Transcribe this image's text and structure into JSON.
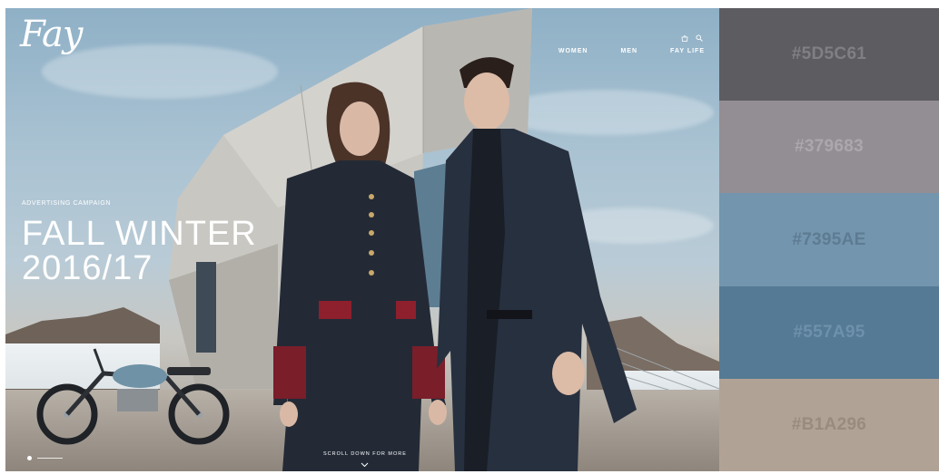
{
  "brand": {
    "logo_text": "Fay"
  },
  "nav": {
    "items": [
      "WOMEN",
      "MEN",
      "FAY LIFE"
    ]
  },
  "utility": {
    "icons": [
      "bag-icon",
      "search-icon"
    ]
  },
  "hero": {
    "kicker": "ADVERTISING CAMPAIGN",
    "headline_line1": "FALL WINTER",
    "headline_line2": "2016/17",
    "scroll_text": "SCROLL DOWN FOR MORE"
  },
  "palette": {
    "swatches": [
      {
        "label": "#5D5C61",
        "color": "#5D5C61",
        "text_color": "#807f84"
      },
      {
        "label": "#379683",
        "color": "#938E94",
        "text_color": "#aca7ad"
      },
      {
        "label": "#7395AE",
        "color": "#7395AE",
        "text_color": "#5d7b92"
      },
      {
        "label": "#557A95",
        "color": "#557A95",
        "text_color": "#6e91ab"
      },
      {
        "label": "#B1A296",
        "color": "#B1A296",
        "text_color": "#9a8b7f"
      }
    ]
  }
}
